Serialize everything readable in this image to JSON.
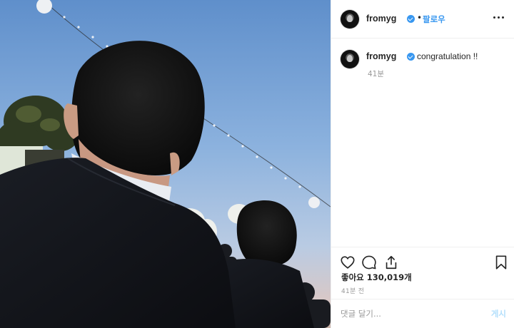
{
  "post": {
    "username": "fromyg",
    "follow_label": "팔로우",
    "caption": "congratulation !!",
    "comment_age": "41분",
    "likes_text": "좋아요 130,019개",
    "posted_ago": "41분 전",
    "comment_placeholder": "댓글 달기...",
    "post_label": "게시"
  },
  "icons": {
    "like": "heart-icon",
    "comment": "speech-bubble-icon",
    "share": "share-icon",
    "save": "bookmark-icon",
    "more": "more-options-icon",
    "verified": "verified-badge-icon"
  },
  "colors": {
    "accent": "#3897f0",
    "text": "#262626",
    "muted": "#999999",
    "divider": "#efefef"
  }
}
